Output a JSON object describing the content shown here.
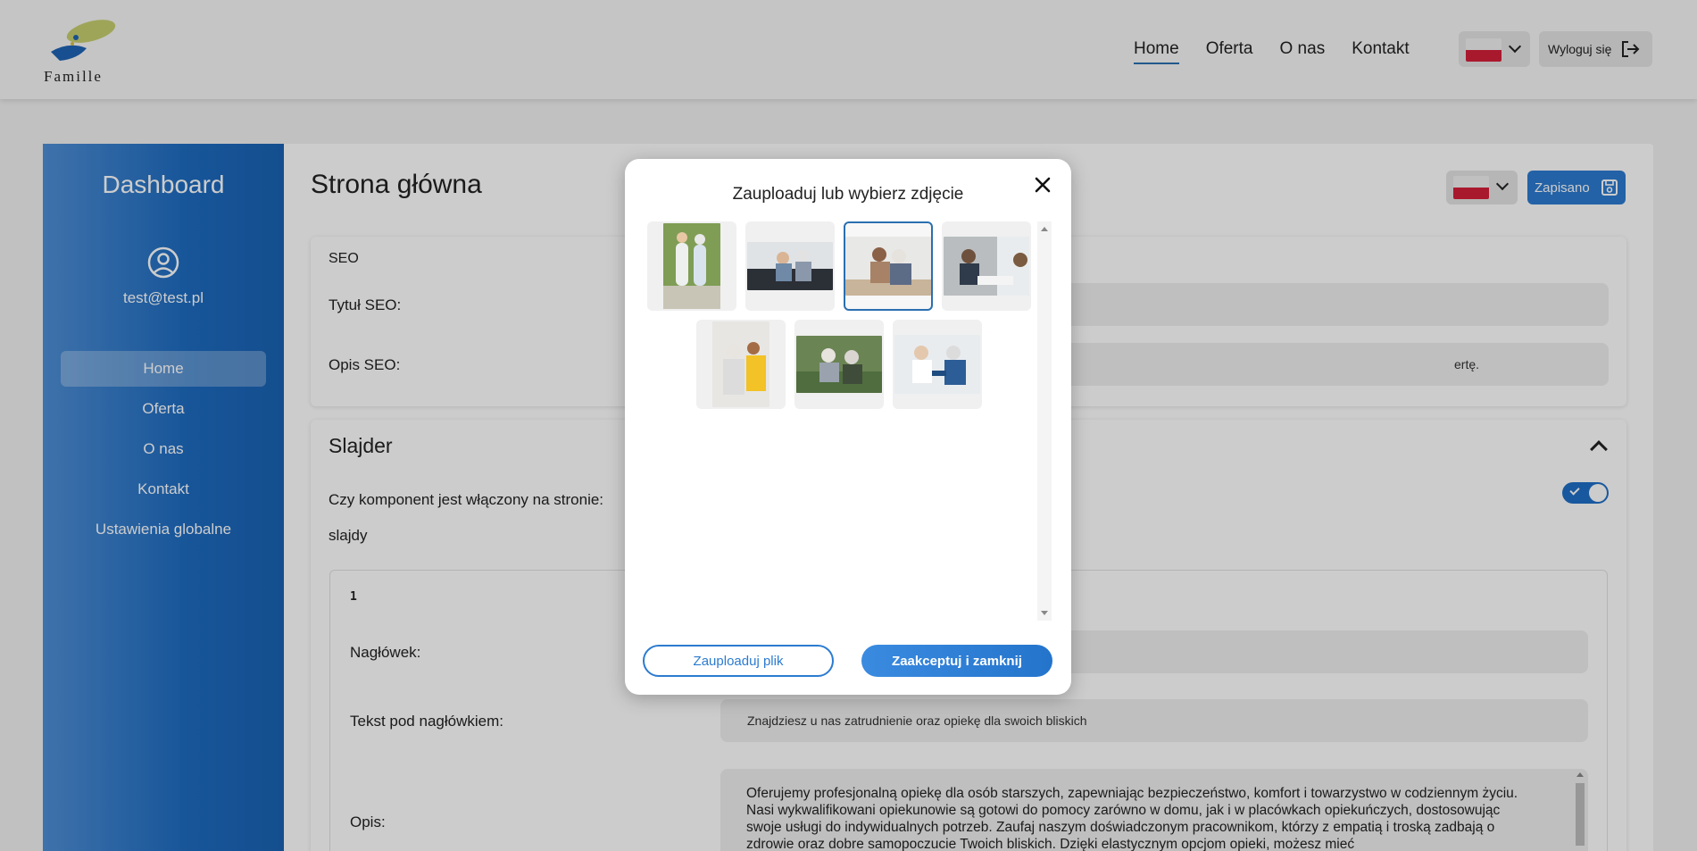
{
  "navbar": {
    "logo_text": "Famille",
    "links": [
      "Home",
      "Oferta",
      "O nas",
      "Kontakt"
    ],
    "logout_label": "Wyloguj się"
  },
  "sidebar": {
    "title": "Dashboard",
    "email": "test@test.pl",
    "items": [
      "Home",
      "Oferta",
      "O nas",
      "Kontakt",
      "Ustawienia globalne"
    ]
  },
  "content": {
    "title": "Strona główna",
    "save_label": "Zapisano",
    "seo": {
      "section_label": "SEO",
      "title_label": "Tytuł SEO:",
      "desc_label": "Opis SEO:",
      "desc_value_visible": "ertę."
    },
    "slider": {
      "title": "Slajder",
      "enabled_label": "Czy komponent jest włączony na stronie:",
      "slides_label": "slajdy",
      "slide_number": "1",
      "heading_label": "Nagłówek:",
      "subtext_label": "Tekst pod nagłówkiem:",
      "subtext_value": "Znajdziesz u nas zatrudnienie oraz opiekę dla swoich bliskich",
      "desc_label": "Opis:",
      "desc_value": "Oferujemy profesjonalną opiekę dla osób starszych, zapewniając bezpieczeństwo, komfort i towarzystwo w codziennym życiu. Nasi wykwalifikowani opiekunowie są gotowi do pomocy zarówno w domu, jak i w placówkach opiekuńczych, dostosowując swoje usługi do indywidualnych potrzeb. Zaufaj naszym doświadczonym pracownikom, którzy z empatią i troską zadbają o zdrowie oraz dobre samopoczucie Twoich bliskich. Dzięki elastycznym opcjom opieki, możesz mieć"
    }
  },
  "modal": {
    "title": "Zauploaduj lub wybierz zdjęcie",
    "upload_label": "Zauploaduj plik",
    "accept_label": "Zaakceptuj i zamknij",
    "images": [
      {
        "name": "caregiver-walking-with-elderly",
        "selected": false
      },
      {
        "name": "seniors-on-sofa",
        "selected": false
      },
      {
        "name": "caregiver-hugging-senior",
        "selected": true
      },
      {
        "name": "office-consultation",
        "selected": false
      },
      {
        "name": "nurse-with-senior-man",
        "selected": false
      },
      {
        "name": "seniors-outdoors",
        "selected": false
      },
      {
        "name": "nurse-measuring-blood-pressure",
        "selected": false
      }
    ]
  },
  "colors": {
    "accent": "#2c7bd0",
    "sidebar": "#1d6bc0",
    "flag_red": "#d4203a"
  }
}
